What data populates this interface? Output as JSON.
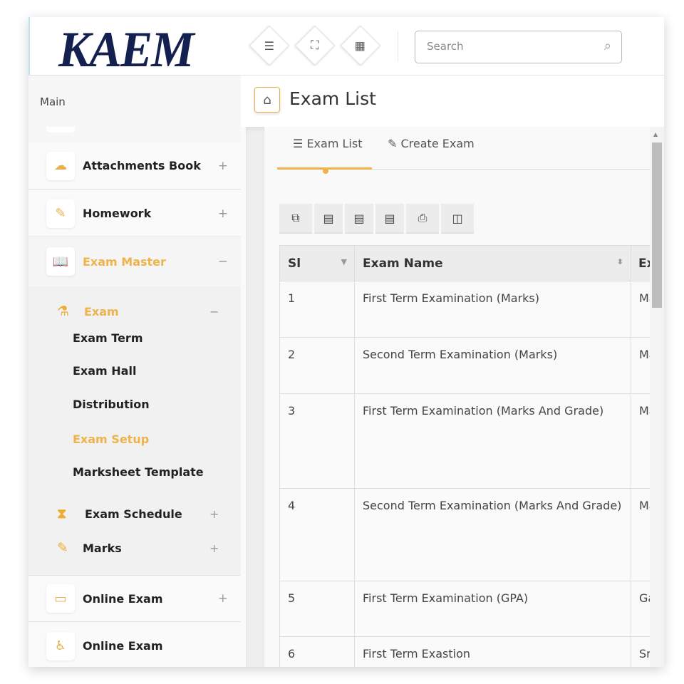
{
  "header": {
    "logo": "KAEM",
    "buttons": [
      {
        "icon": "menu-icon",
        "glyph": "☰"
      },
      {
        "icon": "fullscreen-icon",
        "glyph": "⛶"
      },
      {
        "icon": "grid-icon",
        "glyph": "▦"
      }
    ],
    "search_placeholder": "Search"
  },
  "sidebar": {
    "section": "Main",
    "items": [
      {
        "label": "Attachments Book",
        "toggle": "+"
      },
      {
        "label": "Homework",
        "toggle": "+"
      },
      {
        "label": "Exam Master",
        "toggle": "−"
      },
      {
        "label": "Online Exam",
        "toggle": "+"
      },
      {
        "label": "Online Exam"
      }
    ],
    "sub": {
      "label": "Exam",
      "toggle": "−",
      "children": [
        "Exam Term",
        "Exam Hall",
        "Distribution",
        "Exam Setup",
        "Marksheet Template"
      ]
    },
    "siblings": [
      {
        "label": "Exam Schedule",
        "toggle": "+"
      },
      {
        "label": "Marks",
        "toggle": "+"
      }
    ]
  },
  "page": {
    "title": "Exam List"
  },
  "tabs": [
    {
      "label": "Exam List"
    },
    {
      "label": "Create Exam"
    }
  ],
  "table": {
    "columns": [
      "Sl",
      "Exam Name",
      "Ex"
    ],
    "rows": [
      [
        "1",
        "First Term Examination (Marks)",
        "Ma"
      ],
      [
        "2",
        "Second Term Examination (Marks)",
        "Ma"
      ],
      [
        "3",
        "First Term Examination (Marks And Grade)",
        "Ma"
      ],
      [
        "4",
        "Second Term Examination (Marks And Grade)",
        "Ma"
      ],
      [
        "5",
        "First Term Examination (GPA)",
        "Ga"
      ],
      [
        "6",
        "First Term Exastion",
        "Sr"
      ]
    ]
  },
  "colors": {
    "accent": "#f0b24a",
    "logo": "#14204f"
  }
}
